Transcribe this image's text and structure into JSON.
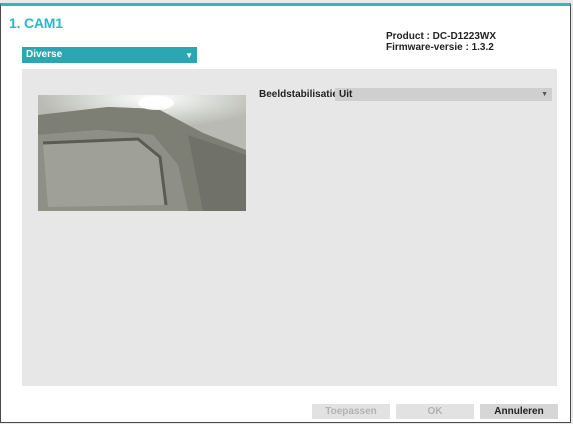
{
  "header": {
    "camera_title": "1. CAM1",
    "product_label": "Product : DC-D1223WX",
    "firmware_label": "Firmware-versie : 1.3.2"
  },
  "category_dropdown": {
    "selected": "Diverse",
    "arrow_icon": "chevron-down-icon"
  },
  "settings": {
    "image_stabilization_label": "Beeldstabilisatie",
    "image_stabilization_value": "Uit"
  },
  "buttons": {
    "apply": "Toepassen",
    "ok": "OK",
    "cancel": "Annuleren"
  },
  "colors": {
    "accent": "#2bb7c4",
    "dropdown_bg": "#2aa7b3",
    "panel_bg": "#e7e7e7"
  }
}
